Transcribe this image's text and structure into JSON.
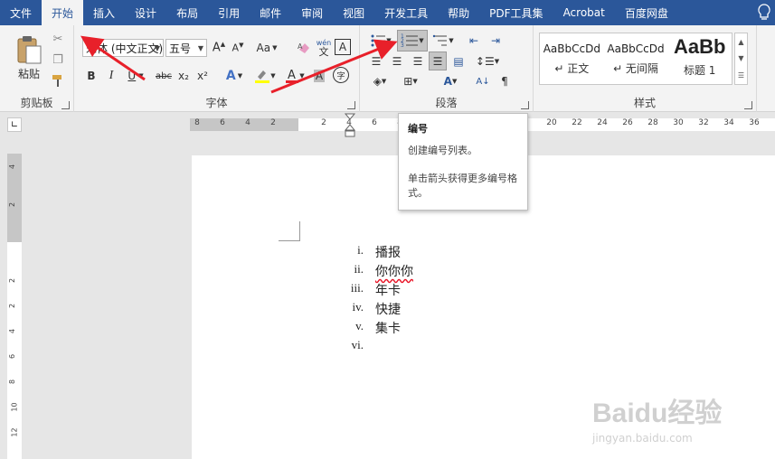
{
  "tabs": [
    "文件",
    "开始",
    "插入",
    "设计",
    "布局",
    "引用",
    "邮件",
    "审阅",
    "视图",
    "开发工具",
    "帮助",
    "PDF工具集",
    "Acrobat",
    "百度网盘"
  ],
  "active_tab": "开始",
  "clipboard": {
    "paste_label": "粘贴",
    "group_label": "剪贴板"
  },
  "font": {
    "font_name": "宋体 (中文正文)",
    "font_size": "五号",
    "group_label": "字体",
    "bold": "B",
    "italic": "I",
    "underline": "U",
    "strike": "abc",
    "sub": "x₂",
    "sup": "x²",
    "case": "Aa",
    "pinyin_top": "wén",
    "pinyin_bottom": "文",
    "border_char": "A",
    "enclose": "字"
  },
  "paragraph": {
    "group_label": "段落"
  },
  "styles": {
    "group_label": "样式",
    "items": [
      {
        "sample": "AaBbCcDd",
        "name": "↵ 正文"
      },
      {
        "sample": "AaBbCcDd",
        "name": "↵ 无间隔"
      },
      {
        "sample": "AaBb",
        "name": "标题 1"
      }
    ]
  },
  "hruler_ticks": [
    "8",
    "6",
    "4",
    "2",
    "2",
    "4",
    "6",
    "8",
    "20",
    "22",
    "24",
    "26",
    "28",
    "30",
    "32",
    "34",
    "36"
  ],
  "vruler_ticks": [
    "4",
    "2",
    "2",
    "2",
    "4",
    "6",
    "8",
    "10",
    "12"
  ],
  "document": {
    "items": [
      {
        "num": "i.",
        "text": "播报"
      },
      {
        "num": "ii.",
        "text": "你你你"
      },
      {
        "num": "iii.",
        "text": "年卡"
      },
      {
        "num": "iv.",
        "text": "快捷"
      },
      {
        "num": "v.",
        "text": "集卡"
      },
      {
        "num": "vi.",
        "text": ""
      }
    ]
  },
  "tooltip": {
    "title": "编号",
    "line1": "创建编号列表。",
    "line2": "单击箭头获得更多编号格式。"
  },
  "watermark": {
    "logo": "Baidu经验",
    "url": "jingyan.baidu.com"
  },
  "colors": {
    "ribbon_blue": "#2b579a",
    "arrow_red": "#e8202a"
  }
}
